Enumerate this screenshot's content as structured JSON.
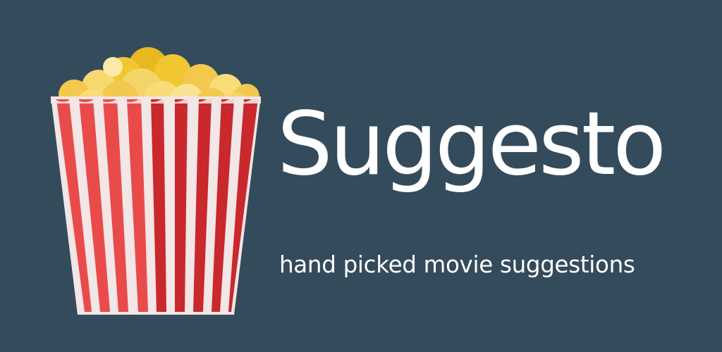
{
  "brand": {
    "name": "Suggesto",
    "tagline": "hand picked movie suggestions"
  },
  "colors": {
    "background": "#344b5c",
    "text": "#ffffff",
    "stripe_red": "#c9282d",
    "stripe_red_light": "#e94b4b",
    "stripe_white": "#f2e6e6",
    "popcorn_yellow": "#f2c94c"
  },
  "icons": {
    "logo": "popcorn-box-icon"
  }
}
